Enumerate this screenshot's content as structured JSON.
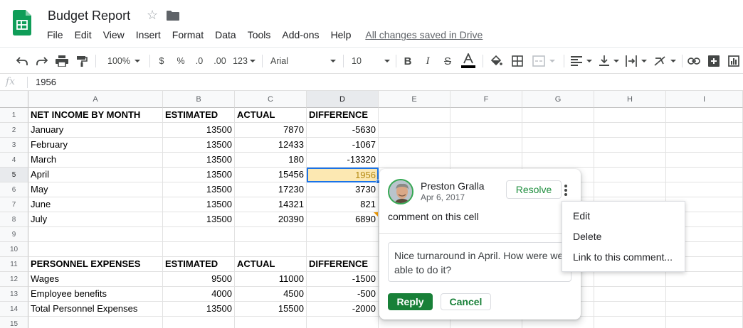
{
  "app": {
    "title": "Budget Report",
    "save_status": "All changes saved in Drive",
    "menu": [
      "File",
      "Edit",
      "View",
      "Insert",
      "Format",
      "Data",
      "Tools",
      "Add-ons",
      "Help"
    ]
  },
  "toolbar": {
    "zoom": "100%",
    "currency": "$",
    "percent": "%",
    "decrease_decimals": ".0",
    "increase_decimals": ".00",
    "more_formats": "123",
    "font": "Arial",
    "font_size": "10"
  },
  "formula_bar": {
    "fx_label": "fx",
    "value": "1956"
  },
  "columns": [
    "A",
    "B",
    "C",
    "D",
    "E",
    "F",
    "G",
    "H",
    "I"
  ],
  "rows": [
    "1",
    "2",
    "3",
    "4",
    "5",
    "6",
    "7",
    "8",
    "9",
    "10",
    "11",
    "12",
    "13",
    "14",
    "15"
  ],
  "active_cell": "D5",
  "cells": [
    [
      "NET INCOME BY MONTH",
      "ESTIMATED",
      "ACTUAL",
      "DIFFERENCE"
    ],
    [
      "January",
      "13500",
      "7870",
      "-5630"
    ],
    [
      "February",
      "13500",
      "12433",
      "-1067"
    ],
    [
      "March",
      "13500",
      "180",
      "-13320"
    ],
    [
      "April",
      "13500",
      "15456",
      "1956"
    ],
    [
      "May",
      "13500",
      "17230",
      "3730"
    ],
    [
      "June",
      "13500",
      "14321",
      "821"
    ],
    [
      "July",
      "13500",
      "20390",
      "6890"
    ],
    [
      "",
      "",
      "",
      ""
    ],
    [
      "",
      "",
      "",
      ""
    ],
    [
      "PERSONNEL EXPENSES",
      "ESTIMATED",
      "ACTUAL",
      "DIFFERENCE"
    ],
    [
      "Wages",
      "9500",
      "11000",
      "-1500"
    ],
    [
      "Employee benefits",
      "4000",
      "4500",
      "-500"
    ],
    [
      "Total Personnel Expenses",
      "13500",
      "15500",
      "-2000"
    ],
    [
      "",
      "",
      "",
      ""
    ]
  ],
  "comment": {
    "author": "Preston Gralla",
    "date": "Apr 6, 2017",
    "text": "comment on this cell",
    "resolve_label": "Resolve",
    "reply_text": "Nice turnaround in April. How were we able to do it?",
    "reply_label": "Reply",
    "cancel_label": "Cancel"
  },
  "context_menu": {
    "items": [
      "Edit",
      "Delete",
      "Link to this comment..."
    ]
  },
  "colors": {
    "sheets_green": "#0f9d58",
    "accent_green": "#188038",
    "selection_blue": "#1a73e8",
    "active_cell_fill": "#fce8b2"
  }
}
